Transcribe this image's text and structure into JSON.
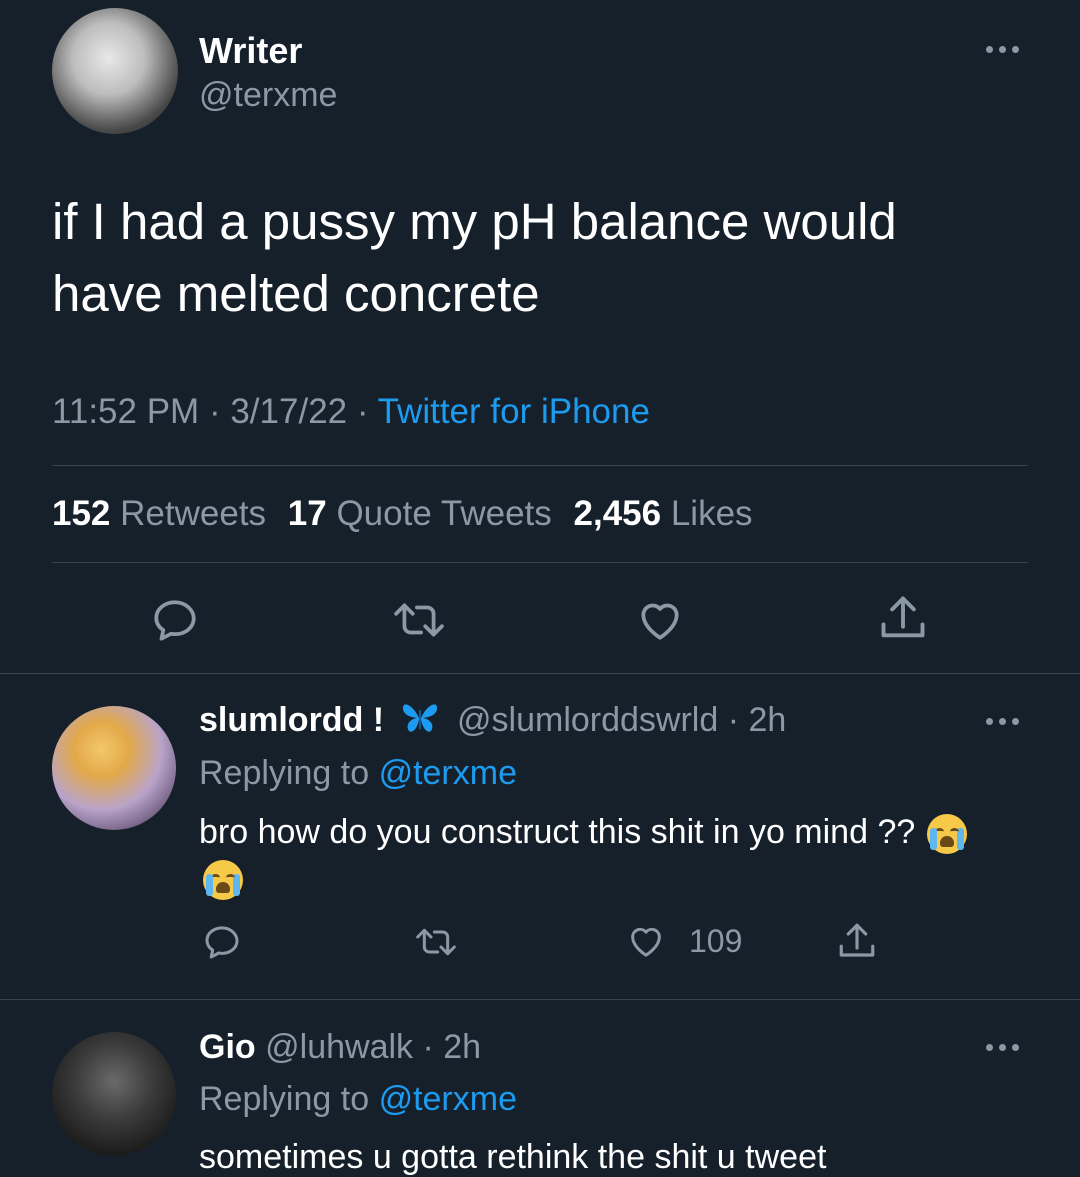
{
  "main_tweet": {
    "author_name": "Writer",
    "author_handle": "@terxme",
    "text_line1": "if I had a pussy my pH balance would",
    "text_line2": "have melted concrete",
    "time": "11:52 PM",
    "date": "3/17/22",
    "source": "Twitter for iPhone",
    "stats": {
      "retweets_count": "152",
      "retweets_label": "Retweets",
      "quotes_count": "17",
      "quotes_label": "Quote Tweets",
      "likes_count": "2,456",
      "likes_label": "Likes"
    }
  },
  "replies": [
    {
      "name": "slumlordd !",
      "handle": "@slumlorddswrld",
      "time": "2h",
      "replying_prefix": "Replying to",
      "replying_to": "@terxme",
      "text": "bro how do you construct this shit in yo mind ??",
      "like_count": "109"
    },
    {
      "name": "Gio",
      "handle": "@luhwalk",
      "time": "2h",
      "replying_prefix": "Replying to",
      "replying_to": "@terxme",
      "text": "sometimes u gotta rethink the shit u tweet"
    }
  ],
  "separator": "·",
  "icons": [
    "more-icon",
    "reply-icon",
    "retweet-icon",
    "like-icon",
    "share-icon",
    "butterfly-icon",
    "loudly-crying-face-emoji"
  ],
  "colors": {
    "background": "#15202b",
    "accent": "#1d9bf0",
    "muted": "#8b98a5",
    "divider": "#38444d"
  }
}
